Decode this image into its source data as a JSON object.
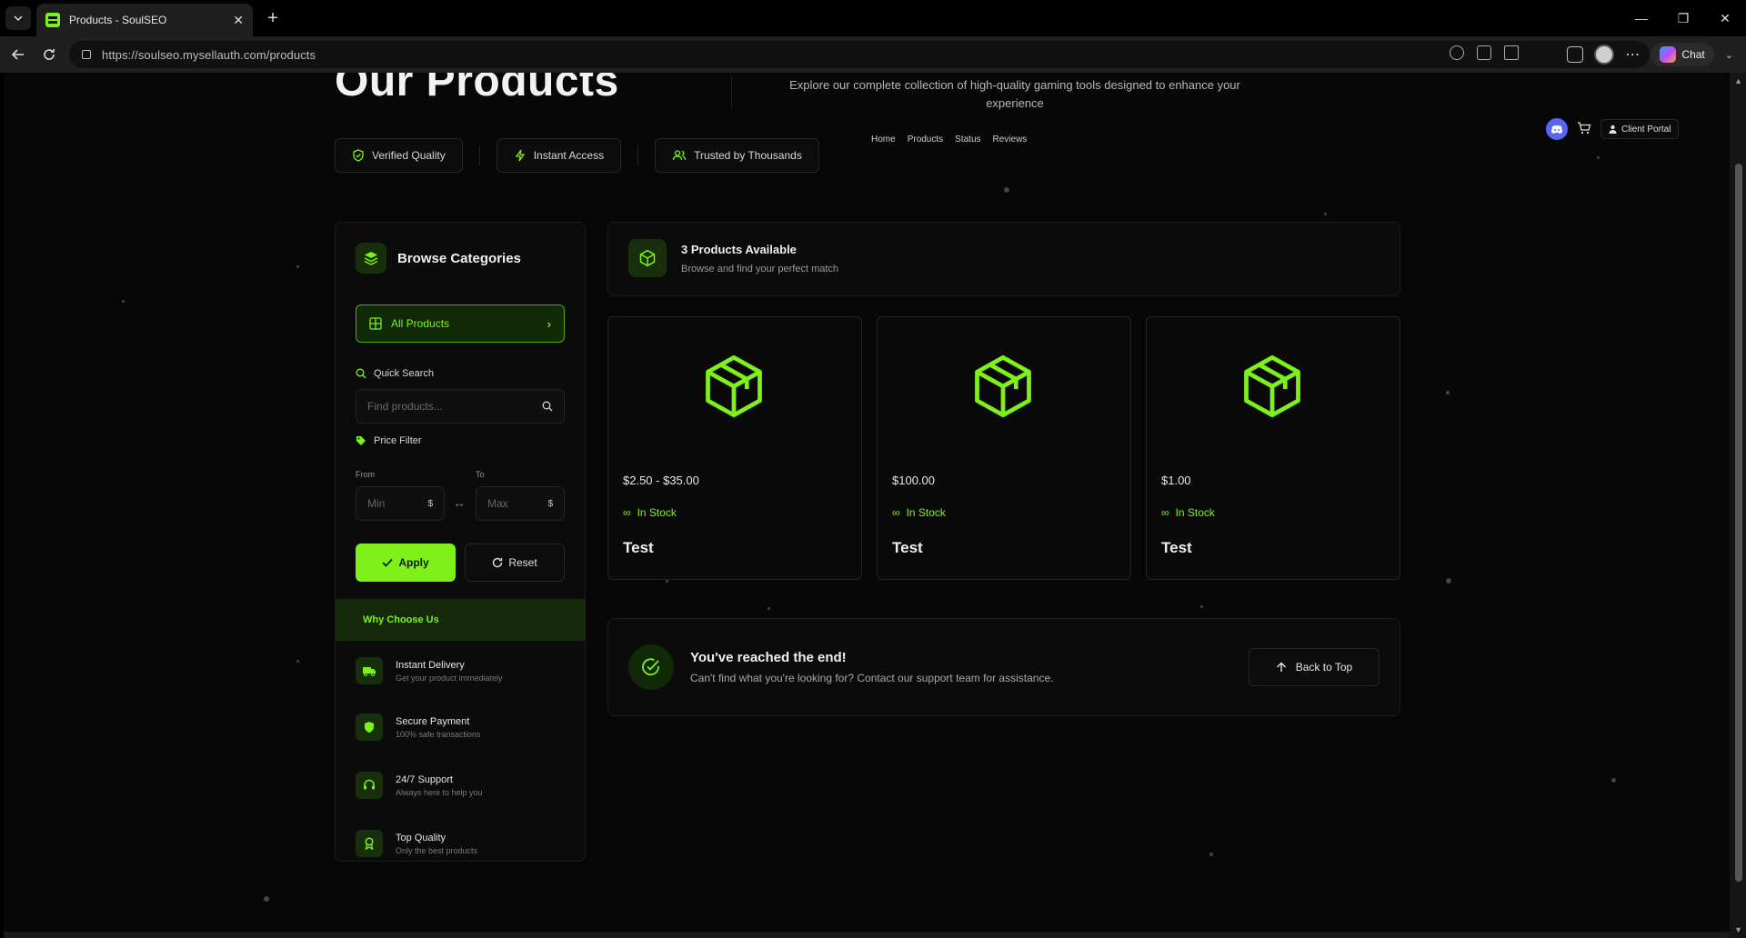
{
  "browser": {
    "tab_title": "Products - SoulSEO",
    "tab_close": "✕",
    "new_tab": "+",
    "url": "https://soulseo.mysellauth.com/products",
    "chat_label": "Chat",
    "window_controls": [
      "—",
      "❐",
      "✕"
    ]
  },
  "hero": {
    "title": "Our Products",
    "description": "Explore our complete collection of high-quality gaming tools designed to enhance your experience",
    "badges": [
      "Verified Quality",
      "Instant Access",
      "Trusted by Thousands"
    ]
  },
  "nav": {
    "links": [
      "Home",
      "Products",
      "Status",
      "Reviews"
    ],
    "client_portal": "Client Portal"
  },
  "sidebar": {
    "title": "Browse Categories",
    "all_products": "All Products",
    "quick_search_label": "Quick Search",
    "search_placeholder": "Find products...",
    "price_filter_label": "Price Filter",
    "from_label": "From",
    "to_label": "To",
    "min_placeholder": "Min",
    "max_placeholder": "Max",
    "currency": "$",
    "apply": "Apply",
    "reset": "Reset",
    "why_title": "Why Choose Us",
    "features": [
      {
        "title": "Instant Delivery",
        "sub": "Get your product immediately",
        "icon": "truck-icon"
      },
      {
        "title": "Secure Payment",
        "sub": "100% safe transactions",
        "icon": "shield-icon"
      },
      {
        "title": "24/7 Support",
        "sub": "Always here to help you",
        "icon": "headset-icon"
      },
      {
        "title": "Top Quality",
        "sub": "Only the best products",
        "icon": "award-icon"
      }
    ]
  },
  "main": {
    "available_title": "3 Products Available",
    "available_sub": "Browse and find your perfect match",
    "products": [
      {
        "price": "$2.50 - $35.00",
        "stock": "In Stock",
        "name": "Test"
      },
      {
        "price": "$100.00",
        "stock": "In Stock",
        "name": "Test"
      },
      {
        "price": "$1.00",
        "stock": "In Stock",
        "name": "Test"
      }
    ],
    "end_title": "You've reached the end!",
    "end_sub": "Can't find what you're looking for? Contact our support team for assistance.",
    "back_to_top": "Back to Top"
  },
  "colors": {
    "accent": "#7ef01a",
    "background": "#070707",
    "panel": "#0b0b0b"
  }
}
